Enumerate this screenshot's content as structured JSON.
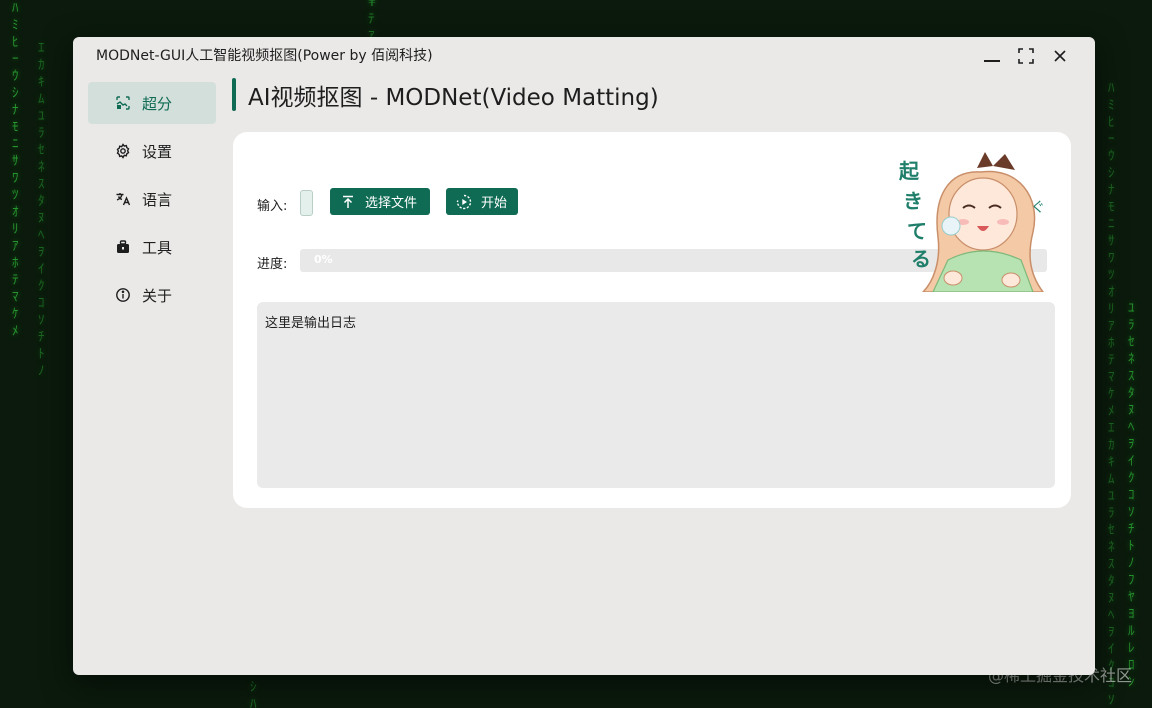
{
  "background": {
    "watermark": "@稀土掘金技术社区"
  },
  "window": {
    "title": "MODNet-GUI人工智能视频抠图(Power by 佰阅科技)",
    "controls": [
      "minimize-icon",
      "maximize-icon",
      "close-icon"
    ]
  },
  "sidebar": {
    "items": [
      {
        "label": "超分",
        "icon": "image-enhance-icon",
        "active": true
      },
      {
        "label": "设置",
        "icon": "gear-icon",
        "active": false
      },
      {
        "label": "语言",
        "icon": "translate-icon",
        "active": false
      },
      {
        "label": "工具",
        "icon": "toolbox-icon",
        "active": false
      },
      {
        "label": "关于",
        "icon": "info-icon",
        "active": false
      }
    ]
  },
  "main": {
    "title": "AI视频抠图 - MODNet(Video Matting)",
    "input_label": "输入:",
    "input_value": "",
    "select_file_label": "选择文件",
    "start_label": "开始",
    "progress_label": "进度:",
    "progress_percent": 0,
    "progress_text": "0%",
    "log_text": "这里是输出日志",
    "mascot_text": "起きてる"
  },
  "colors": {
    "accent": "#0f6b53",
    "active_nav_bg": "#d2dfda",
    "window_bg": "#ebe9e8",
    "card_bg": "#ffffff",
    "matrix_green": "#2fbf3a"
  }
}
